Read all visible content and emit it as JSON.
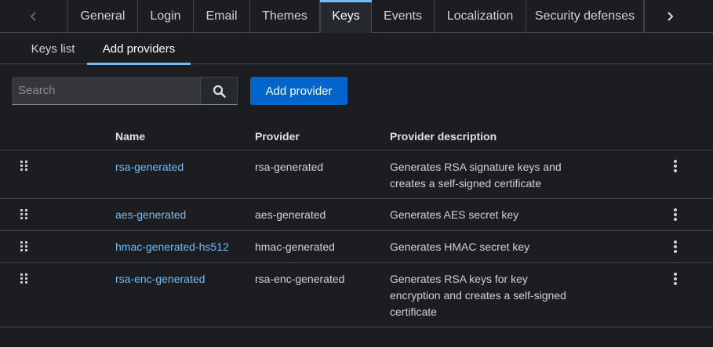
{
  "tabs": [
    {
      "label": "General"
    },
    {
      "label": "Login"
    },
    {
      "label": "Email"
    },
    {
      "label": "Themes"
    },
    {
      "label": "Keys"
    },
    {
      "label": "Events"
    },
    {
      "label": "Localization"
    },
    {
      "label": "Security defenses"
    }
  ],
  "active_tab": "Keys",
  "subtabs": [
    {
      "label": "Keys list"
    },
    {
      "label": "Add providers"
    }
  ],
  "active_subtab": "Add providers",
  "toolbar": {
    "search_placeholder": "Search",
    "search_value": "",
    "add_provider_label": "Add provider"
  },
  "table": {
    "columns": [
      "Name",
      "Provider",
      "Provider description"
    ],
    "rows": [
      {
        "name": "rsa-generated",
        "provider": "rsa-generated",
        "description": "Generates RSA signature keys and creates a self-signed certificate"
      },
      {
        "name": "aes-generated",
        "provider": "aes-generated",
        "description": "Generates AES secret key"
      },
      {
        "name": "hmac-generated-hs512",
        "provider": "hmac-generated",
        "description": "Generates HMAC secret key"
      },
      {
        "name": "rsa-enc-generated",
        "provider": "rsa-enc-generated",
        "description": "Generates RSA keys for key encryption and creates a self-signed certificate"
      }
    ]
  },
  "colors": {
    "accent": "#73bcf7",
    "primary_button": "#0066cc",
    "background": "#1b1d21"
  },
  "icons": {
    "scroll_left": "chevron-left-icon",
    "scroll_right": "chevron-right-icon",
    "search": "search-icon",
    "drag": "grip-vertical-icon",
    "actions": "kebab-icon"
  }
}
